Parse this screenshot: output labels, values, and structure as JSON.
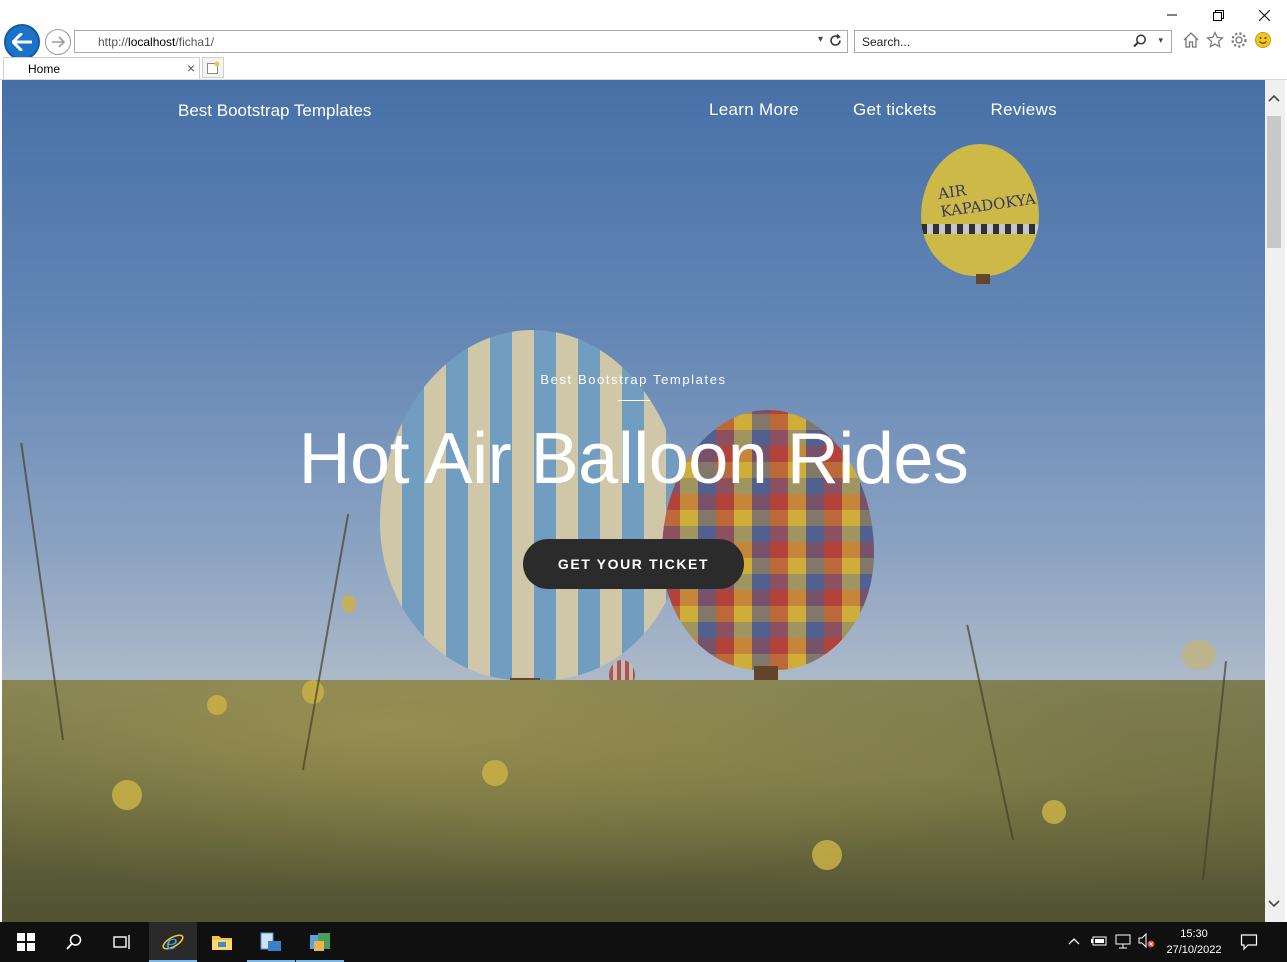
{
  "browser": {
    "url_prefix": "http://",
    "url_host": "localhost",
    "url_path": "/ficha1/",
    "search_placeholder": "Search...",
    "tab_label": "Home"
  },
  "page": {
    "brand": "Best Bootstrap Templates",
    "nav": [
      {
        "label": "Learn More"
      },
      {
        "label": "Get tickets"
      },
      {
        "label": "Reviews"
      }
    ],
    "kicker": "Best Bootstrap Templates",
    "hero_title": "Hot Air Balloon Rides",
    "cta_label": "GET YOUR TICKET"
  },
  "balloon_text": "AIR KAPADOKYA",
  "taskbar": {
    "time": "15:30",
    "date": "27/10/2022"
  },
  "colors": {
    "cta_bg": "#2b2b2b",
    "back_button": "#1a73c9",
    "taskbar_bg": "#101010"
  }
}
